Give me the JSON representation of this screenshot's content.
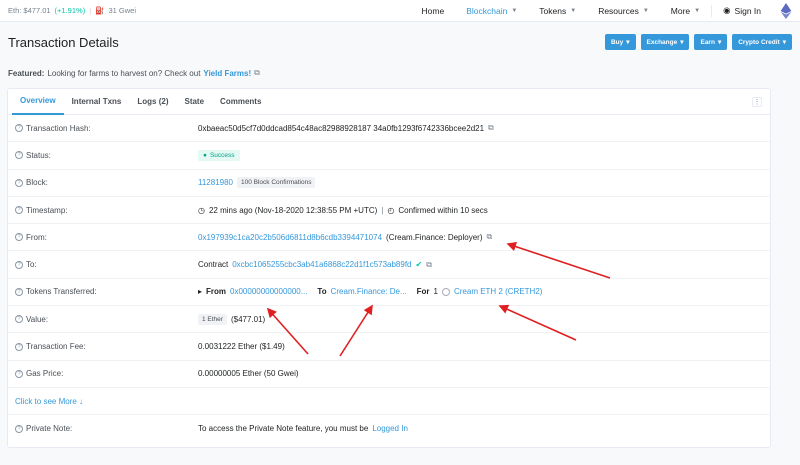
{
  "topbar": {
    "eth_price": "Eth: $477.01",
    "eth_change": "(+1.91%)",
    "gas": "31 Gwei"
  },
  "nav": {
    "items": [
      {
        "label": "Home",
        "caret": false
      },
      {
        "label": "Blockchain",
        "caret": true
      },
      {
        "label": "Tokens",
        "caret": true
      },
      {
        "label": "Resources",
        "caret": true
      },
      {
        "label": "More",
        "caret": true
      }
    ],
    "signin": "Sign In"
  },
  "header": {
    "title": "Transaction Details",
    "buttons": [
      "Buy",
      "Exchange",
      "Earn",
      "Crypto Credit"
    ]
  },
  "featured": {
    "label": "Featured:",
    "text": "Looking for farms to harvest on? Check out",
    "link": "Yield Farms!"
  },
  "tabs": [
    "Overview",
    "Internal Txns",
    "Logs (2)",
    "State",
    "Comments"
  ],
  "rows": {
    "hash": {
      "label": "Transaction Hash:",
      "value": "0xbaeac50d5cf7d0ddcad854c48ac82988928187 34a0fb1293f6742336bcee2d21"
    },
    "status": {
      "label": "Status:",
      "value": "Success"
    },
    "block": {
      "label": "Block:",
      "value": "11281980",
      "confirmations": "100 Block Confirmations"
    },
    "timestamp": {
      "label": "Timestamp:",
      "value": "22 mins ago (Nov-18-2020 12:38:55 PM +UTC)",
      "confirmed": "Confirmed within 10 secs"
    },
    "from": {
      "label": "From:",
      "address": "0x197939c1ca20c2b506d6811d8b6cdb3394471074",
      "name": "(Cream.Finance: Deployer)"
    },
    "to": {
      "label": "To:",
      "prefix": "Contract",
      "address": "0xcbc1065255cbc3ab41a6868c22d1f1c573ab89fd"
    },
    "tokens": {
      "label": "Tokens Transferred:",
      "from_label": "From",
      "from_addr": "0x00000000000000...",
      "to_label": "To",
      "to_addr": "Cream.Finance: De...",
      "for_label": "For",
      "amount": "1",
      "token": "Cream ETH 2 (CRETH2)"
    },
    "value": {
      "label": "Value:",
      "ether": "1 Ether",
      "usd": "($477.01)"
    },
    "fee": {
      "label": "Transaction Fee:",
      "value": "0.0031222 Ether ($1.49)"
    },
    "gas": {
      "label": "Gas Price:",
      "value": "0.00000005 Ether (50 Gwei)"
    },
    "seemore": "Click to see More",
    "note": {
      "label": "Private Note:",
      "text": "To access the Private Note feature, you must be",
      "link": "Logged In"
    }
  },
  "colors": {
    "accent": "#3498db",
    "success": "#00c9a7",
    "annotation": "#e02020"
  }
}
